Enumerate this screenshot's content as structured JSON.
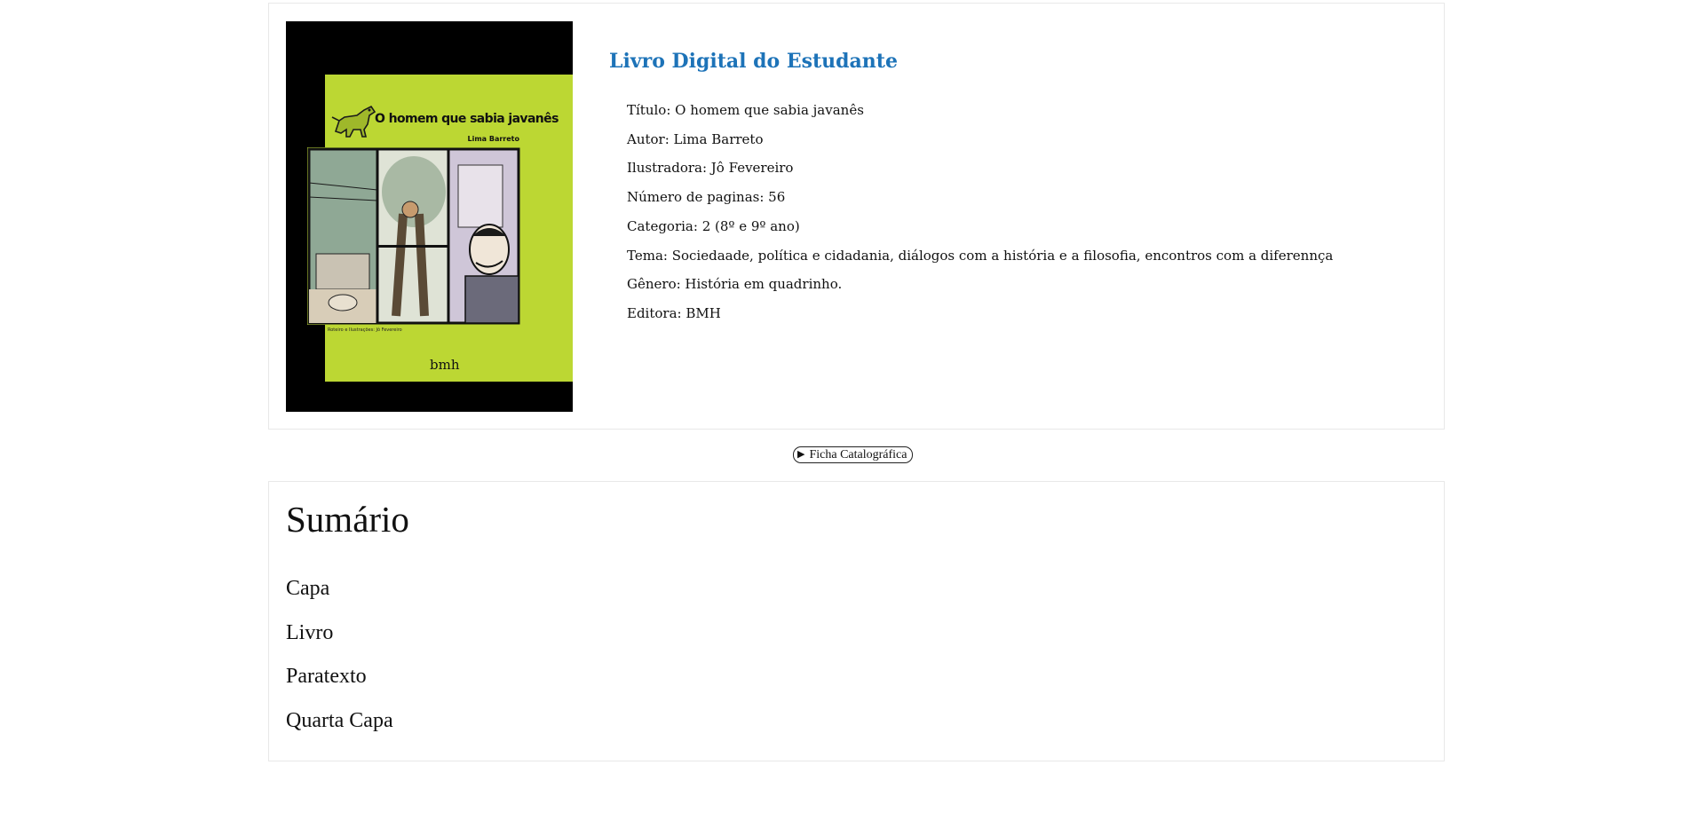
{
  "book": {
    "heading": "Livro Digital do Estudante",
    "cover": {
      "title": "O homem que sabia javanês",
      "author": "Lima Barreto",
      "credits": "Roteiro e Ilustrações: Jô Fevereiro",
      "publisher": "bmh",
      "colors": {
        "background": "#000000",
        "art": "#bcd733"
      }
    },
    "meta": [
      "Título: O homem que sabia javanês",
      "Autor: Lima Barreto",
      "Ilustradora: Jô Fevereiro",
      "Número de paginas: 56",
      "Categoria: 2 (8º e 9º ano)",
      "Tema: Sociedaade, política e cidadania, diálogos com a história e a filosofia, encontros com a diferennça",
      "Gênero: História em quadrinho.",
      "Editora: BMH"
    ]
  },
  "ficha": {
    "icon": "triangle-right-icon",
    "label": "Ficha Catalográfica"
  },
  "summary": {
    "title": "Sumário",
    "items": [
      "Capa",
      "Livro",
      "Paratexto",
      "Quarta Capa"
    ]
  },
  "colors": {
    "heading": "#1d73b8",
    "border": "#e8e8e8"
  }
}
